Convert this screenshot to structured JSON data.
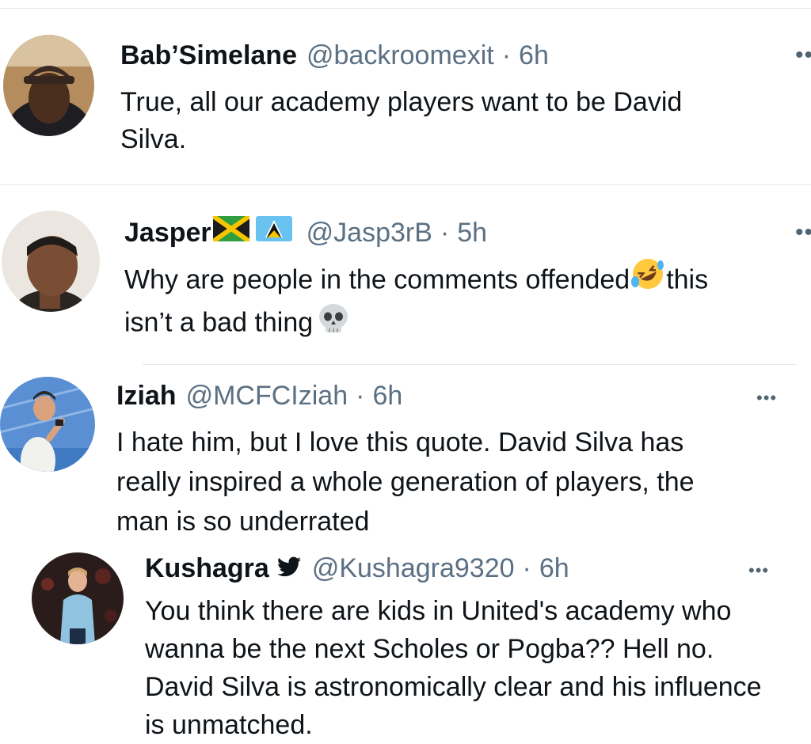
{
  "tweets": [
    {
      "name": "Bab’Simelane",
      "handle": "@backroomexit",
      "separator": "·",
      "time": "6h",
      "lines": [
        "True, all our academy players want to be David",
        "Silva."
      ]
    },
    {
      "name": "Jasper",
      "flags": [
        "jamaica-flag",
        "saint-lucia-flag"
      ],
      "handle": "@Jasp3rB",
      "separator": "·",
      "time": "5h",
      "line1_a": "Why are people in the comments offended",
      "line1_emoji": "rolling-on-floor-laughing-emoji",
      "line1_b": "this",
      "line2_a": "isn’t a bad thing",
      "line2_emoji": "skull-emoji"
    },
    {
      "name": "Iziah",
      "handle": "@MCFCIziah",
      "separator": "·",
      "time": "6h",
      "more": "•••",
      "lines": [
        "I hate him, but I love this quote. David Silva has",
        "really inspired a whole generation of players, the",
        "man is so underrated"
      ]
    },
    {
      "name": "Kushagra",
      "badge_icon": "twitter-bird-icon",
      "handle": "@Kushagra9320",
      "separator": "·",
      "time": "6h",
      "more": "•••",
      "lines": [
        "You think there are kids in United's academy who",
        "wanna be the next Scholes or Pogba?? Hell no.",
        "David Silva is astronomically clear and his influence",
        "is unmatched."
      ]
    }
  ],
  "colors": {
    "text": "#0f1419",
    "secondary": "#5b7083",
    "divider": "#e6e9ec",
    "twitter_blue": "#1d9bf0"
  }
}
